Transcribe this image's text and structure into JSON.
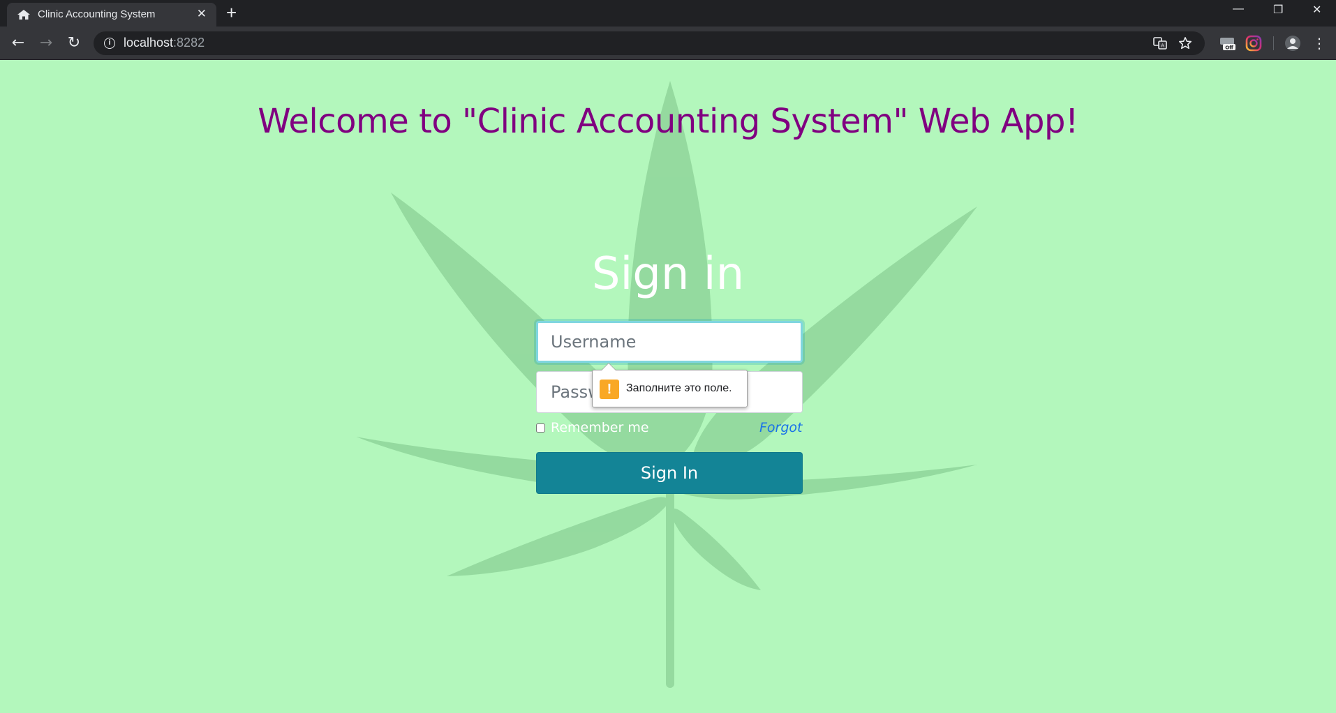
{
  "browser": {
    "tab_title": "Clinic Accounting System",
    "tab_icon": "home-icon",
    "url_host": "localhost",
    "url_port": ":8282",
    "new_tab_label": "+",
    "window_controls": {
      "minimize": "—",
      "restore": "❐",
      "close": "✕"
    }
  },
  "page": {
    "welcome_heading": "Welcome to \"Clinic Accounting System\" Web App!",
    "signin_heading": "Sign in",
    "username_placeholder": "Username",
    "password_placeholder": "Password",
    "remember_label": "Remember me",
    "remember_checked": false,
    "forgot_link": "Forgot",
    "signin_button": "Sign In",
    "validation_message": "Заполните это поле.",
    "validation_icon": "!"
  },
  "colors": {
    "page_background": "#b3f7bc",
    "welcome_text": "#800080",
    "signin_button": "#138496",
    "forgot_link": "#1a73e8",
    "leaf_watermark": "#8fd59a"
  }
}
